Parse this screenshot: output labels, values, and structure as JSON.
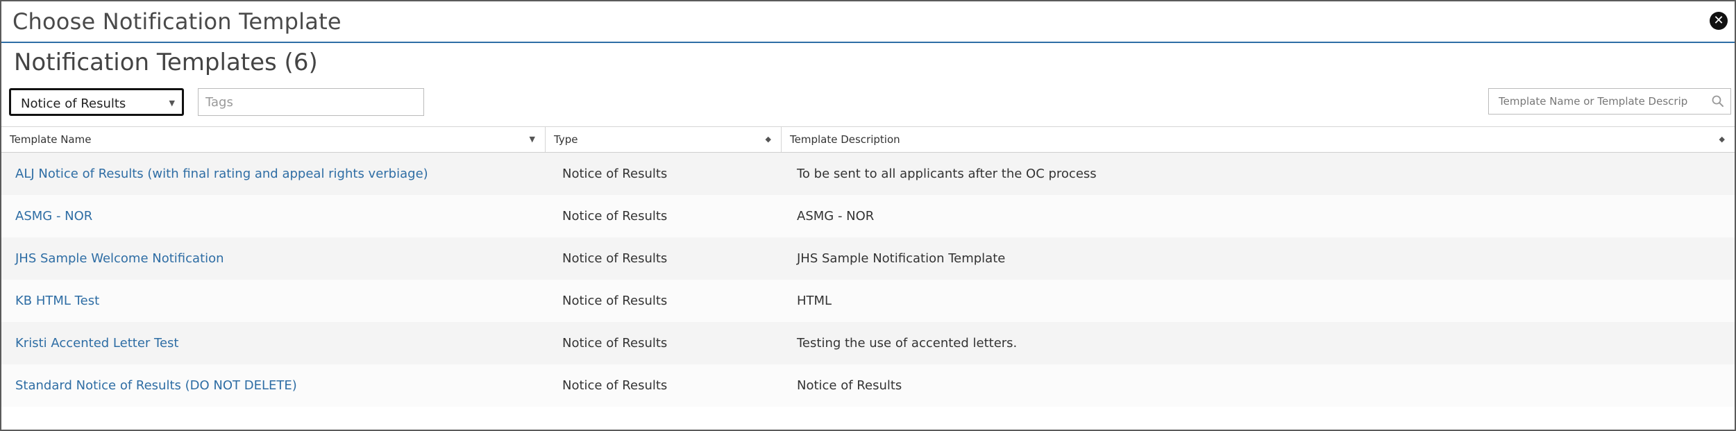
{
  "dialog": {
    "title": "Choose Notification Template"
  },
  "heading": "Notification Templates (6)",
  "filters": {
    "type_select": {
      "value": "Notice of Results"
    },
    "tags": {
      "placeholder": "Tags",
      "value": ""
    },
    "search": {
      "placeholder": "Template Name or Template Description",
      "value": ""
    }
  },
  "table": {
    "columns": [
      "Template Name",
      "Type",
      "Template Description"
    ],
    "rows": [
      {
        "name": "ALJ Notice of Results (with final rating and appeal rights verbiage)",
        "type": "Notice of Results",
        "description": "To be sent to all applicants after the OC process"
      },
      {
        "name": "ASMG - NOR",
        "type": "Notice of Results",
        "description": "ASMG - NOR"
      },
      {
        "name": "JHS Sample Welcome Notification",
        "type": "Notice of Results",
        "description": "JHS Sample Notification Template"
      },
      {
        "name": "KB HTML Test",
        "type": "Notice of Results",
        "description": "HTML"
      },
      {
        "name": "Kristi Accented Letter Test",
        "type": "Notice of Results",
        "description": "Testing the use of accented letters."
      },
      {
        "name": "Standard Notice of Results (DO NOT DELETE)",
        "type": "Notice of Results",
        "description": "Notice of Results"
      }
    ]
  },
  "icons": {
    "close": "close-circle-icon",
    "search": "search-icon",
    "dropdown": "caret-down-icon",
    "sort_name": "sort-down-icon",
    "sort_type": "sort-both-icon",
    "sort_desc": "sort-both-icon"
  },
  "colors": {
    "accent_border": "#2f6ea6",
    "link": "#2e6da4",
    "row_alt": "#f4f4f4"
  }
}
